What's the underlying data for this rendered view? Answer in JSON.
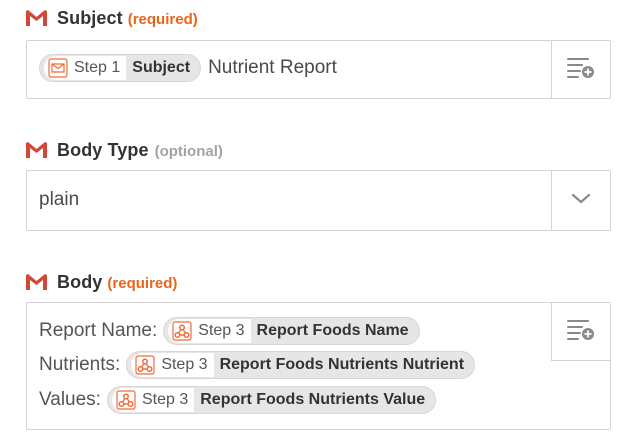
{
  "subject": {
    "label": "Subject",
    "tag": "(required)",
    "pill": {
      "step": "Step 1",
      "field": "Subject"
    },
    "value": "Nutrient Report",
    "insert_icon": "insert-field-icon"
  },
  "body_type": {
    "label": "Body Type",
    "tag": "(optional)",
    "value": "plain",
    "dropdown_icon": "chevron-down-icon"
  },
  "body": {
    "label": "Body",
    "tag": "(required)",
    "insert_icon": "insert-field-icon",
    "lines": [
      {
        "label": "Report Name:",
        "step": "Step 3",
        "field": "Report Foods Name"
      },
      {
        "label": "Nutrients:",
        "step": "Step 3",
        "field": "Report Foods Nutrients Nutrient"
      },
      {
        "label": "Values:",
        "step": "Step 3",
        "field": "Report Foods Nutrients Value"
      }
    ]
  },
  "colors": {
    "required": "#e8651b",
    "optional": "#a2a2a2",
    "gmail": "#d44638",
    "app": "#f26b3a"
  }
}
